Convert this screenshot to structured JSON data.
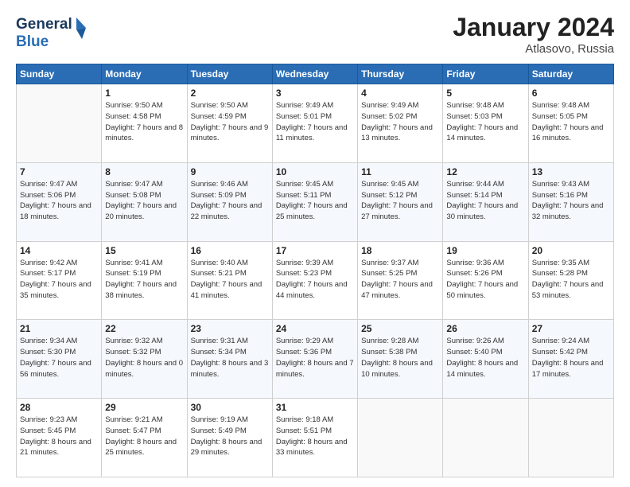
{
  "header": {
    "logo_line1": "General",
    "logo_line2": "Blue",
    "month": "January 2024",
    "location": "Atlasovo, Russia"
  },
  "days_of_week": [
    "Sunday",
    "Monday",
    "Tuesday",
    "Wednesday",
    "Thursday",
    "Friday",
    "Saturday"
  ],
  "weeks": [
    [
      {
        "day": "",
        "sunrise": "",
        "sunset": "",
        "daylight": ""
      },
      {
        "day": "1",
        "sunrise": "Sunrise: 9:50 AM",
        "sunset": "Sunset: 4:58 PM",
        "daylight": "Daylight: 7 hours and 8 minutes."
      },
      {
        "day": "2",
        "sunrise": "Sunrise: 9:50 AM",
        "sunset": "Sunset: 4:59 PM",
        "daylight": "Daylight: 7 hours and 9 minutes."
      },
      {
        "day": "3",
        "sunrise": "Sunrise: 9:49 AM",
        "sunset": "Sunset: 5:01 PM",
        "daylight": "Daylight: 7 hours and 11 minutes."
      },
      {
        "day": "4",
        "sunrise": "Sunrise: 9:49 AM",
        "sunset": "Sunset: 5:02 PM",
        "daylight": "Daylight: 7 hours and 13 minutes."
      },
      {
        "day": "5",
        "sunrise": "Sunrise: 9:48 AM",
        "sunset": "Sunset: 5:03 PM",
        "daylight": "Daylight: 7 hours and 14 minutes."
      },
      {
        "day": "6",
        "sunrise": "Sunrise: 9:48 AM",
        "sunset": "Sunset: 5:05 PM",
        "daylight": "Daylight: 7 hours and 16 minutes."
      }
    ],
    [
      {
        "day": "7",
        "sunrise": "Sunrise: 9:47 AM",
        "sunset": "Sunset: 5:06 PM",
        "daylight": "Daylight: 7 hours and 18 minutes."
      },
      {
        "day": "8",
        "sunrise": "Sunrise: 9:47 AM",
        "sunset": "Sunset: 5:08 PM",
        "daylight": "Daylight: 7 hours and 20 minutes."
      },
      {
        "day": "9",
        "sunrise": "Sunrise: 9:46 AM",
        "sunset": "Sunset: 5:09 PM",
        "daylight": "Daylight: 7 hours and 22 minutes."
      },
      {
        "day": "10",
        "sunrise": "Sunrise: 9:45 AM",
        "sunset": "Sunset: 5:11 PM",
        "daylight": "Daylight: 7 hours and 25 minutes."
      },
      {
        "day": "11",
        "sunrise": "Sunrise: 9:45 AM",
        "sunset": "Sunset: 5:12 PM",
        "daylight": "Daylight: 7 hours and 27 minutes."
      },
      {
        "day": "12",
        "sunrise": "Sunrise: 9:44 AM",
        "sunset": "Sunset: 5:14 PM",
        "daylight": "Daylight: 7 hours and 30 minutes."
      },
      {
        "day": "13",
        "sunrise": "Sunrise: 9:43 AM",
        "sunset": "Sunset: 5:16 PM",
        "daylight": "Daylight: 7 hours and 32 minutes."
      }
    ],
    [
      {
        "day": "14",
        "sunrise": "Sunrise: 9:42 AM",
        "sunset": "Sunset: 5:17 PM",
        "daylight": "Daylight: 7 hours and 35 minutes."
      },
      {
        "day": "15",
        "sunrise": "Sunrise: 9:41 AM",
        "sunset": "Sunset: 5:19 PM",
        "daylight": "Daylight: 7 hours and 38 minutes."
      },
      {
        "day": "16",
        "sunrise": "Sunrise: 9:40 AM",
        "sunset": "Sunset: 5:21 PM",
        "daylight": "Daylight: 7 hours and 41 minutes."
      },
      {
        "day": "17",
        "sunrise": "Sunrise: 9:39 AM",
        "sunset": "Sunset: 5:23 PM",
        "daylight": "Daylight: 7 hours and 44 minutes."
      },
      {
        "day": "18",
        "sunrise": "Sunrise: 9:37 AM",
        "sunset": "Sunset: 5:25 PM",
        "daylight": "Daylight: 7 hours and 47 minutes."
      },
      {
        "day": "19",
        "sunrise": "Sunrise: 9:36 AM",
        "sunset": "Sunset: 5:26 PM",
        "daylight": "Daylight: 7 hours and 50 minutes."
      },
      {
        "day": "20",
        "sunrise": "Sunrise: 9:35 AM",
        "sunset": "Sunset: 5:28 PM",
        "daylight": "Daylight: 7 hours and 53 minutes."
      }
    ],
    [
      {
        "day": "21",
        "sunrise": "Sunrise: 9:34 AM",
        "sunset": "Sunset: 5:30 PM",
        "daylight": "Daylight: 7 hours and 56 minutes."
      },
      {
        "day": "22",
        "sunrise": "Sunrise: 9:32 AM",
        "sunset": "Sunset: 5:32 PM",
        "daylight": "Daylight: 8 hours and 0 minutes."
      },
      {
        "day": "23",
        "sunrise": "Sunrise: 9:31 AM",
        "sunset": "Sunset: 5:34 PM",
        "daylight": "Daylight: 8 hours and 3 minutes."
      },
      {
        "day": "24",
        "sunrise": "Sunrise: 9:29 AM",
        "sunset": "Sunset: 5:36 PM",
        "daylight": "Daylight: 8 hours and 7 minutes."
      },
      {
        "day": "25",
        "sunrise": "Sunrise: 9:28 AM",
        "sunset": "Sunset: 5:38 PM",
        "daylight": "Daylight: 8 hours and 10 minutes."
      },
      {
        "day": "26",
        "sunrise": "Sunrise: 9:26 AM",
        "sunset": "Sunset: 5:40 PM",
        "daylight": "Daylight: 8 hours and 14 minutes."
      },
      {
        "day": "27",
        "sunrise": "Sunrise: 9:24 AM",
        "sunset": "Sunset: 5:42 PM",
        "daylight": "Daylight: 8 hours and 17 minutes."
      }
    ],
    [
      {
        "day": "28",
        "sunrise": "Sunrise: 9:23 AM",
        "sunset": "Sunset: 5:45 PM",
        "daylight": "Daylight: 8 hours and 21 minutes."
      },
      {
        "day": "29",
        "sunrise": "Sunrise: 9:21 AM",
        "sunset": "Sunset: 5:47 PM",
        "daylight": "Daylight: 8 hours and 25 minutes."
      },
      {
        "day": "30",
        "sunrise": "Sunrise: 9:19 AM",
        "sunset": "Sunset: 5:49 PM",
        "daylight": "Daylight: 8 hours and 29 minutes."
      },
      {
        "day": "31",
        "sunrise": "Sunrise: 9:18 AM",
        "sunset": "Sunset: 5:51 PM",
        "daylight": "Daylight: 8 hours and 33 minutes."
      },
      {
        "day": "",
        "sunrise": "",
        "sunset": "",
        "daylight": ""
      },
      {
        "day": "",
        "sunrise": "",
        "sunset": "",
        "daylight": ""
      },
      {
        "day": "",
        "sunrise": "",
        "sunset": "",
        "daylight": ""
      }
    ]
  ]
}
